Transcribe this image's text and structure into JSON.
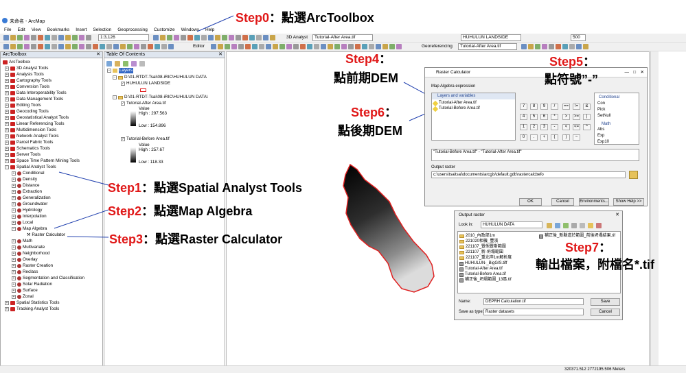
{
  "window": {
    "title": "未命名 - ArcMap"
  },
  "menu": [
    "File",
    "Edit",
    "View",
    "Bookmarks",
    "Insert",
    "Selection",
    "Geoprocessing",
    "Customize",
    "Windows",
    "Help"
  ],
  "toolbar": {
    "scale": "1:3,126",
    "spatial_analyst": "3D Analyst",
    "layer_combo1": "Tutorial-After Area.tif",
    "layer_combo2": "HUHULUN LANDSIDE",
    "zoom": "500",
    "editor": "Editor",
    "georef": "Georeferencing",
    "georef_layer": "Tutorial-After Area.tif"
  },
  "arctoolbox": {
    "title": "ArcToolbox",
    "root": "ArcToolbox",
    "items": [
      "3D Analyst Tools",
      "Analysis Tools",
      "Cartography Tools",
      "Conversion Tools",
      "Data Interoperability Tools",
      "Data Management Tools",
      "Editing Tools",
      "Geocoding Tools",
      "Geostatistical Analyst Tools",
      "Linear Referencing Tools",
      "Multidimension Tools",
      "Network Analyst Tools",
      "Parcel Fabric Tools",
      "Schematics Tools",
      "Server Tools",
      "Space Time Pattern Mining Tools",
      "Spatial Analyst Tools"
    ],
    "spatial_children": [
      "Conditional",
      "Density",
      "Distance",
      "Extraction",
      "Generalization",
      "Groundwater",
      "Hydrology",
      "Interpolation",
      "Local",
      "Map Algebra"
    ],
    "map_algebra_child": "Raster Calculator",
    "more_children": [
      "Math",
      "Multivariate",
      "Neighborhood",
      "Overlay",
      "Raster Creation",
      "Reclass",
      "Segmentation and Classification",
      "Solar Radiation",
      "Surface",
      "Zonal"
    ],
    "tail": [
      "Spatial Statistics Tools",
      "Tracking Analyst Tools"
    ]
  },
  "toc": {
    "title": "Table Of Contents",
    "layers_label": "Layers",
    "group1_path": "D:\\01-RTDT-Tsai\\08-iRIC\\HUHULUN DATA",
    "group1_layer": "HUHULUN LANDSIDE",
    "group2_path": "D:\\01-RTDT-Tsai\\08-iRIC\\HUHULUN DATA\\",
    "after_name": "Tutorial-After Area.tif",
    "after_value": "Value",
    "after_high": "High : 297.563",
    "after_low": "Low : 154.896",
    "before_name": "Tutorial-Before Area.tif",
    "before_value": "Value",
    "before_high": "High : 257.67",
    "before_low": "Low : 118.33"
  },
  "steps": {
    "step0": "Step0",
    "step0_text": "：點選ArcToolbox",
    "step1": "Step1",
    "step1_text": "：點選Spatial Analyst Tools",
    "step2": "Step2",
    "step2_text": "：點選Map Algebra",
    "step3": "Step3",
    "step3_text": "：點選Raster Calculator",
    "step4": "Step4",
    "step4_colon": "：",
    "step4_text": "點前期DEM",
    "step5": "Step5",
    "step5_colon": "：",
    "step5_text": "點符號”-”",
    "step6": "Step6",
    "step6_colon": "：",
    "step6_text": "點後期DEM",
    "step7": "Step7",
    "step7_colon": "：",
    "step7_text": "輸出檔案，附檔名*.tif"
  },
  "raster_calc": {
    "title": "Raster Calculator",
    "section": "Map Algebra expression",
    "layers_hdr": "Layers and variables",
    "layer1": "Tutorial-After Area.tif",
    "layer2": "Tutorial-Before Area.tif",
    "keys": [
      "7",
      "8",
      "9",
      "/",
      "==",
      "!=",
      "&",
      "4",
      "5",
      "6",
      "*",
      ">",
      ">=",
      "|",
      "1",
      "2",
      "3",
      "-",
      "<",
      "<=",
      "^",
      "0",
      ".",
      "+",
      "(",
      ")",
      "~"
    ],
    "cond_hdr": "Conditional",
    "cond_items": [
      "Con",
      "Pick",
      "SetNull"
    ],
    "math_hdr": "Math",
    "math_items": [
      "Abs",
      "Exp",
      "Exp10"
    ],
    "expression": "\"Tutorial-Before Area.tif\" - \"Tutorial-After Area.tif\"",
    "output_label": "Output raster",
    "output_path": "c:\\users\\tsaitsai\\documents\\arcgis\\default.gdb\\rastercalcbefo",
    "ok": "OK",
    "cancel": "Cancel",
    "env": "Environments...",
    "help": "Show Help >>"
  },
  "output_raster": {
    "title": "Output raster",
    "lookin_label": "Look in:",
    "lookin": "HUHULUN DATA",
    "files_left": [
      "2010_內政部1m",
      "221020相機_豐濱",
      "221107_豐他豐斯範圍",
      "221107_新-坍塌範圍",
      "221107_重北岸1m解析度",
      "HUHULUN-_BigGIS.tiff",
      "Tutorial-After Area.tif",
      "Tutorial-Before Area.tif",
      "補正後_坍塌範圍_13區.tif"
    ],
    "files_right": [
      "補正後_新縣道於範圍_前後坍塌結果.tif"
    ],
    "name_label": "Name:",
    "name_value": "DEPRH Calculation.tif",
    "type_label": "Save as type:",
    "type_value": "Raster datasets",
    "save": "Save",
    "cancel": "Cancel"
  },
  "status": {
    "coords": "320371.512   2772195.506 Meters"
  },
  "colors": {
    "step_red": "#e01818",
    "step_blue": "#1f3fae",
    "boundary": "#e02020",
    "arrow": "#1f3fae"
  }
}
